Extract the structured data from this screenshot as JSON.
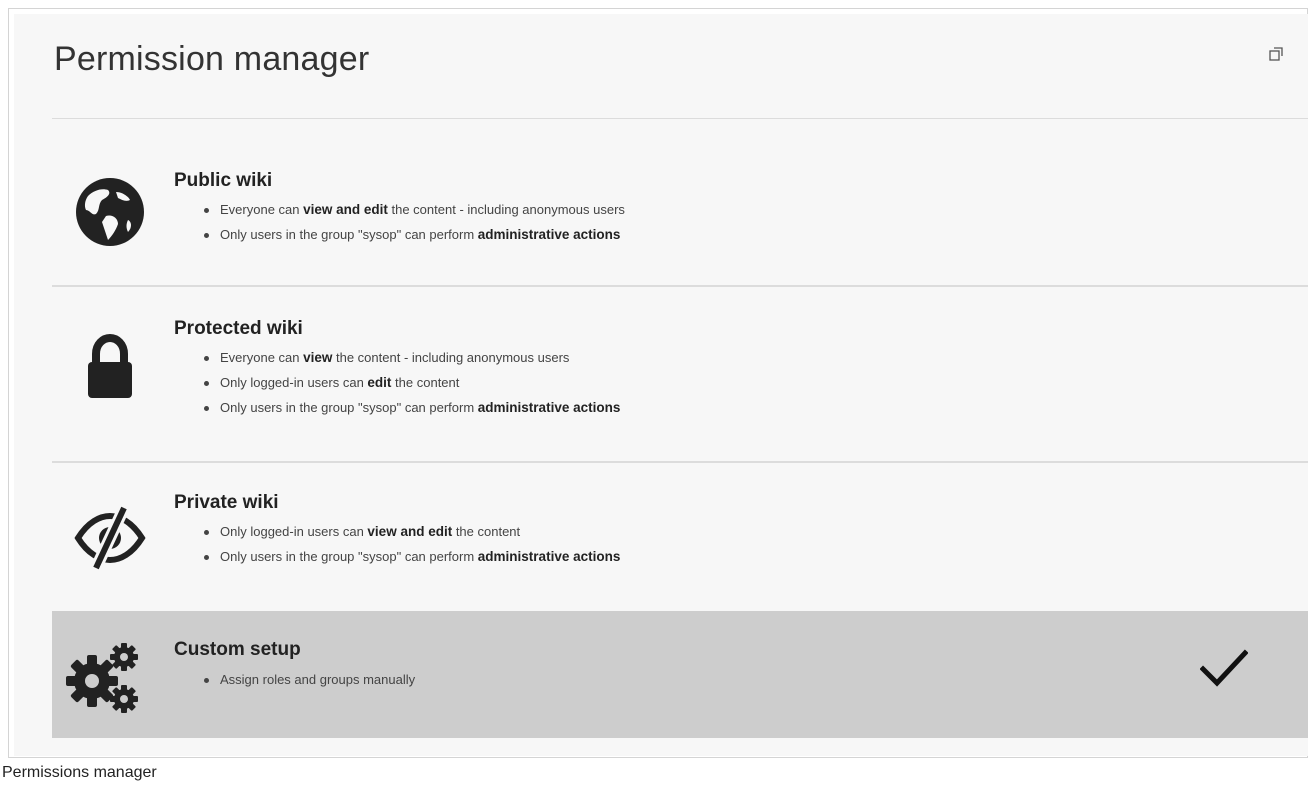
{
  "page": {
    "title": "Permission manager",
    "caption": "Permissions manager"
  },
  "options": [
    {
      "title": "Public wiki",
      "icon": "globe-icon",
      "bullets": [
        {
          "pre": "Everyone can ",
          "bold": "view and edit",
          "post": " the content - including anonymous users"
        },
        {
          "pre": "Only users in the group \"sysop\" can perform ",
          "bold": "administrative actions",
          "post": ""
        }
      ]
    },
    {
      "title": "Protected wiki",
      "icon": "lock-icon",
      "bullets": [
        {
          "pre": "Everyone can ",
          "bold": "view",
          "post": " the content - including anonymous users"
        },
        {
          "pre": "Only logged-in users can ",
          "bold": "edit",
          "post": " the content"
        },
        {
          "pre": "Only users in the group \"sysop\" can perform ",
          "bold": "administrative actions",
          "post": ""
        }
      ]
    },
    {
      "title": "Private wiki",
      "icon": "eye-slash-icon",
      "bullets": [
        {
          "pre": "Only logged-in users can ",
          "bold": "view and edit",
          "post": " the content"
        },
        {
          "pre": "Only users in the group \"sysop\" can perform ",
          "bold": "administrative actions",
          "post": ""
        }
      ]
    },
    {
      "title": "Custom setup",
      "icon": "gears-icon",
      "selected": true,
      "bullets": [
        {
          "pre": "Assign roles and groups manually",
          "bold": "",
          "post": ""
        }
      ]
    }
  ],
  "colors": {
    "panel_bg": "#f7f7f7",
    "selected_bg": "#cdcdcd",
    "icon": "#222222"
  }
}
